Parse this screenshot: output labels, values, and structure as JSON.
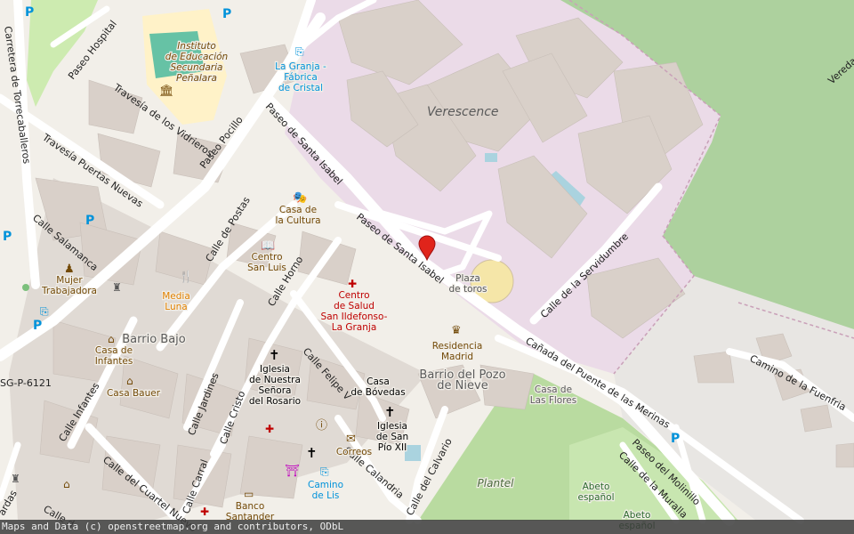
{
  "map": {
    "area_name": "Verescence",
    "pin_label": "",
    "attribution": "Maps and Data (c) openstreetmap.org and contributors, ODbL",
    "colors": {
      "background": "#f2efe9",
      "industrial": "#ebdbe8",
      "forest": "#add19e",
      "grass": "#cdebb0",
      "water": "#aad3df",
      "building": "#d9d0c9",
      "road": "#ffffff",
      "pin": "#e0241b",
      "poi_brown": "#734a08",
      "poi_blue": "#0092da",
      "poi_red": "#bf0000"
    },
    "streets": [
      {
        "id": "paseo-hospital",
        "text": "Paseo Hospital"
      },
      {
        "id": "travesia-vidrieros",
        "text": "Travesía de los Vidrieros"
      },
      {
        "id": "travesia-puertas",
        "text": "Travesía Puertas Nuevas"
      },
      {
        "id": "paseo-pocillo",
        "text": "Paseo Pocillo"
      },
      {
        "id": "paseo-santa-isabel-1",
        "text": "Paseo de Santa Isabel"
      },
      {
        "id": "paseo-santa-isabel-2",
        "text": "Paseo de Santa Isabel"
      },
      {
        "id": "calle-salamanca",
        "text": "Calle Salamanca"
      },
      {
        "id": "calle-postas",
        "text": "Calle de Postas"
      },
      {
        "id": "calle-horno",
        "text": "Calle Horno"
      },
      {
        "id": "calle-felipe",
        "text": "Calle Felipe V"
      },
      {
        "id": "calle-servidumbre",
        "text": "Calle de la Servidumbre"
      },
      {
        "id": "canada-merinas",
        "text": "Cañada del Puente de las Merinas"
      },
      {
        "id": "camino-fuenfria",
        "text": "Camino de la Fuenfria"
      },
      {
        "id": "paseo-molinillo",
        "text": "Paseo del Molinillo"
      },
      {
        "id": "calle-muralla",
        "text": "Calle de la Muralla"
      },
      {
        "id": "calle-infantes",
        "text": "Calle Infantes"
      },
      {
        "id": "calle-jardines",
        "text": "Calle Jardines"
      },
      {
        "id": "calle-cristo",
        "text": "Calle Cristo"
      },
      {
        "id": "calle-carral",
        "text": "Calle Carral"
      },
      {
        "id": "calle-cuartel",
        "text": "Calle del Cuartel Nuevo"
      },
      {
        "id": "calle-calandria",
        "text": "Calle Calandria"
      },
      {
        "id": "calle-calvario",
        "text": "Calle del Calvario"
      },
      {
        "id": "carretera-torrecaballeros",
        "text": "Carretera de Torrecaballeros"
      },
      {
        "id": "vereda",
        "text": "Vereda"
      },
      {
        "id": "road-ref",
        "text": "SG-P-6121"
      },
      {
        "id": "calle-lardas",
        "text": "ardas"
      },
      {
        "id": "calle-d",
        "text": "Calle d"
      }
    ],
    "places": [
      {
        "id": "instituto",
        "lines": [
          "Instituto",
          "de Educación",
          "Secundaria",
          "Peñalara"
        ]
      },
      {
        "id": "la-granja-fabrica",
        "lines": [
          "La Granja -",
          "Fábrica",
          "de Cristal"
        ]
      },
      {
        "id": "casa-cultura",
        "lines": [
          "Casa de",
          "la Cultura"
        ]
      },
      {
        "id": "centro-san-luis",
        "lines": [
          "Centro",
          "San Luis"
        ]
      },
      {
        "id": "mujer-trabajadora",
        "lines": [
          "Mujer",
          "Trabajadora"
        ]
      },
      {
        "id": "media-luna",
        "lines": [
          "Media",
          "Luna"
        ]
      },
      {
        "id": "centro-salud",
        "lines": [
          "Centro",
          "de Salud",
          "San Ildefonso-",
          "La Granja"
        ]
      },
      {
        "id": "plaza-toros",
        "lines": [
          "Plaza",
          "de toros"
        ]
      },
      {
        "id": "barrio-bajo",
        "lines": [
          "Barrio Bajo"
        ]
      },
      {
        "id": "casa-infantes",
        "lines": [
          "Casa de",
          "Infantes"
        ]
      },
      {
        "id": "casa-bauer",
        "lines": [
          "Casa Bauer"
        ]
      },
      {
        "id": "residencia-madrid",
        "lines": [
          "Residencia",
          "Madrid"
        ]
      },
      {
        "id": "barrio-pozo",
        "lines": [
          "Barrio del Pozo",
          "de Nieve"
        ]
      },
      {
        "id": "casa-flores",
        "lines": [
          "Casa de",
          "Las Flores"
        ]
      },
      {
        "id": "iglesia-rosario",
        "lines": [
          "Iglesia",
          "de Nuestra",
          "Señora",
          "del Rosario"
        ]
      },
      {
        "id": "casa-bovedas",
        "lines": [
          "Casa",
          "de Bóvedas"
        ]
      },
      {
        "id": "iglesia-pio",
        "lines": [
          "Iglesia",
          "de San",
          "Pío XII"
        ]
      },
      {
        "id": "correos",
        "lines": [
          "Correos"
        ]
      },
      {
        "id": "camino-lis",
        "lines": [
          "Camino",
          "de Lis"
        ]
      },
      {
        "id": "banco-santander",
        "lines": [
          "Banco",
          "Santander"
        ]
      },
      {
        "id": "plantel",
        "lines": [
          "Plantel"
        ]
      },
      {
        "id": "abeto-1",
        "lines": [
          "Abeto",
          "español"
        ]
      },
      {
        "id": "abeto-2",
        "lines": [
          "Abeto",
          "español"
        ]
      }
    ]
  }
}
